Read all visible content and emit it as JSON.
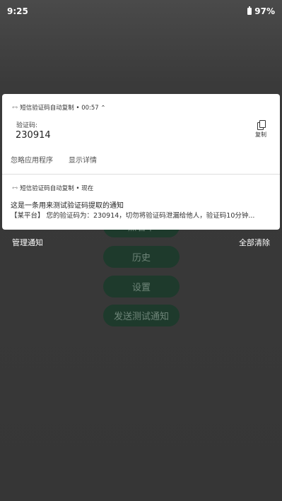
{
  "status_bar": {
    "time": "9:25",
    "battery": "97%"
  },
  "app": {
    "buttons": [
      {
        "label": "黑名单"
      },
      {
        "label": "历史"
      },
      {
        "label": "设置"
      },
      {
        "label": "发送测试通知"
      }
    ]
  },
  "notification1": {
    "app_icon": "‹···›",
    "header": "短信验证码自动复制 • 00:57 ⌃",
    "code_label": "验证码:",
    "code_value": "230914",
    "copy_label": "复制",
    "action_ignore": "忽略应用程序",
    "action_details": "显示详情"
  },
  "notification2": {
    "app_icon": "‹···›",
    "header": "短信验证码自动复制 • 现在",
    "title": "这是一条用来测试验证码提取的通知",
    "body": "【某平台】 您的验证码为：230914，切勿将验证码泄漏给他人，验证码10分钟..."
  },
  "footer": {
    "manage": "管理通知",
    "clear_all": "全部清除"
  },
  "colors": {
    "button_bg": "#1e3a2c",
    "button_text": "#6f8579",
    "shade_bg": "#ffffff"
  }
}
